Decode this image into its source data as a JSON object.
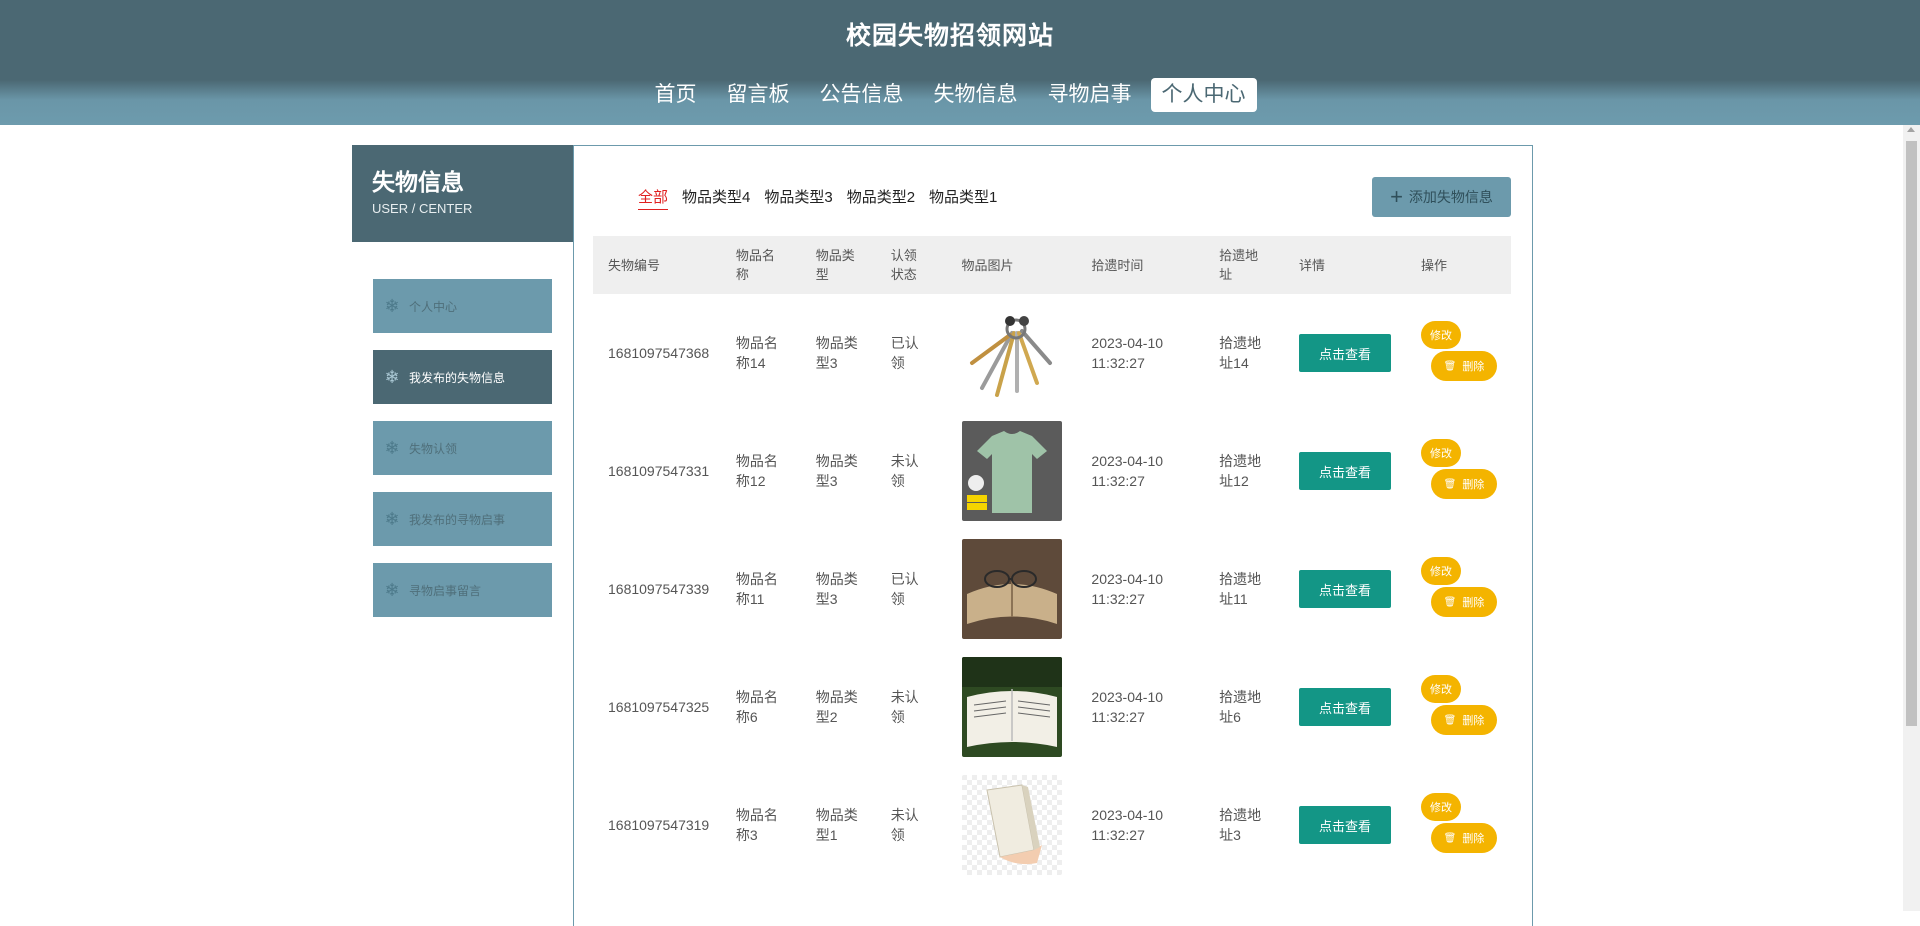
{
  "site": {
    "title": "校园失物招领网站"
  },
  "nav": {
    "items": [
      "首页",
      "留言板",
      "公告信息",
      "失物信息",
      "寻物启事",
      "个人中心"
    ],
    "active": "个人中心"
  },
  "sidebar": {
    "title": "失物信息",
    "subtitle": "USER / CENTER",
    "items": [
      {
        "label": "个人中心",
        "active": false
      },
      {
        "label": "我发布的失物信息",
        "active": true
      },
      {
        "label": "失物认领",
        "active": false
      },
      {
        "label": "我发布的寻物启事",
        "active": false
      },
      {
        "label": "寻物启事留言",
        "active": false
      }
    ]
  },
  "filters": {
    "tabs": [
      "全部",
      "物品类型4",
      "物品类型3",
      "物品类型2",
      "物品类型1"
    ],
    "active": "全部"
  },
  "add_button": {
    "label": "添加失物信息",
    "icon": "plus-icon"
  },
  "table": {
    "headers": [
      "失物编号",
      "物品名称",
      "物品类型",
      "认领状态",
      "物品图片",
      "拾遗时间",
      "拾遗地址",
      "详情",
      "操作"
    ],
    "rows": [
      {
        "id": "1681097547368",
        "name": "物品名称14",
        "type": "物品类型3",
        "status": "已认领",
        "image": "keys",
        "time": "2023-04-10 11:32:27",
        "address": "拾遗地址14"
      },
      {
        "id": "1681097547331",
        "name": "物品名称12",
        "type": "物品类型3",
        "status": "未认领",
        "image": "tshirt",
        "time": "2023-04-10 11:32:27",
        "address": "拾遗地址12"
      },
      {
        "id": "1681097547339",
        "name": "物品名称11",
        "type": "物品类型3",
        "status": "已认领",
        "image": "glasses-book",
        "time": "2023-04-10 11:32:27",
        "address": "拾遗地址11"
      },
      {
        "id": "1681097547325",
        "name": "物品名称6",
        "type": "物品类型2",
        "status": "未认领",
        "image": "book-grass",
        "time": "2023-04-10 11:32:27",
        "address": "拾遗地址6"
      },
      {
        "id": "1681097547319",
        "name": "物品名称3",
        "type": "物品类型1",
        "status": "未认领",
        "image": "hand-book",
        "time": "2023-04-10 11:32:27",
        "address": "拾遗地址3"
      }
    ],
    "detail_label": "点击查看",
    "edit_label": "修改",
    "delete_label": "删除"
  },
  "colors": {
    "header": "#4b6873",
    "sidebar_item": "#6c9aac",
    "detail_button": "#139686",
    "op_button": "#f4b400",
    "active_filter": "#e02020"
  }
}
